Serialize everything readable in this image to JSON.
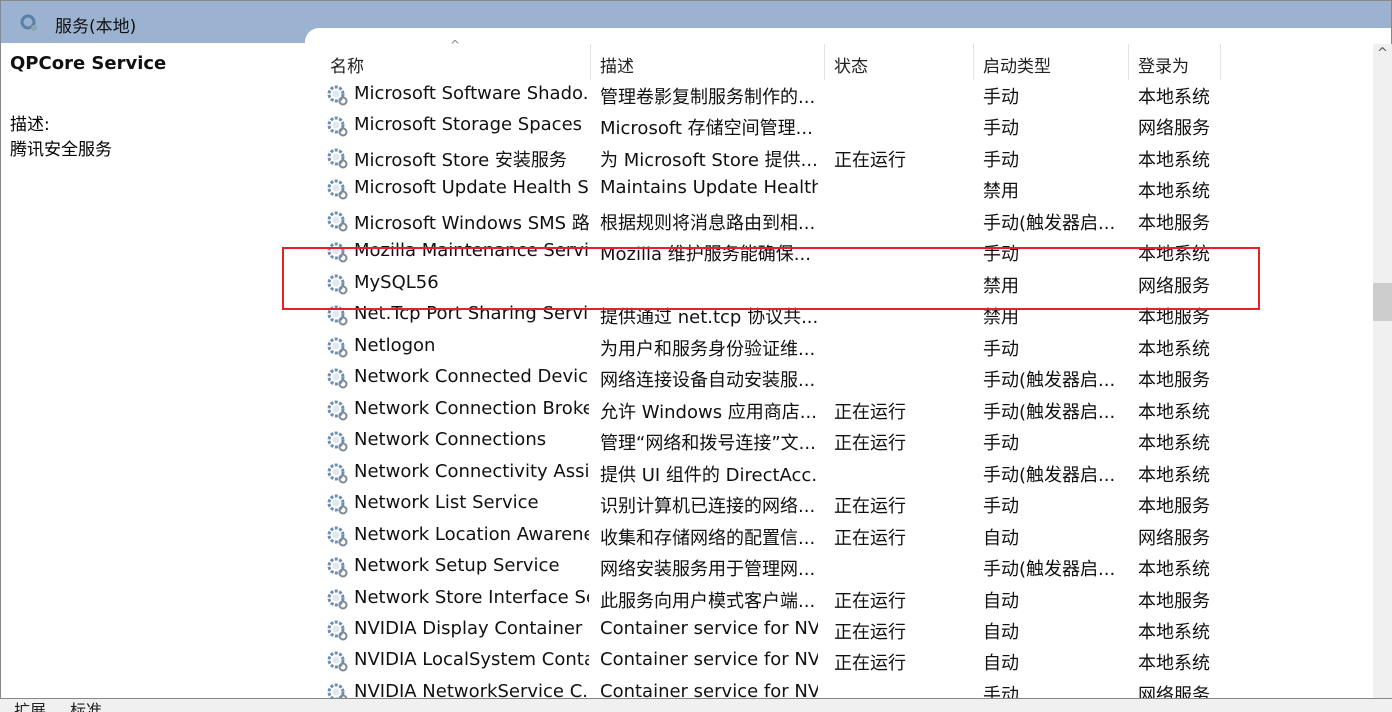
{
  "window": {
    "title": "服务(本地)",
    "icon": "services-gear-icon"
  },
  "details": {
    "service_name": "QPCore Service",
    "description_label": "描述:",
    "description": "腾讯安全服务"
  },
  "columns": [
    "名称",
    "描述",
    "状态",
    "启动类型",
    "登录为"
  ],
  "sort": {
    "column": "名称",
    "direction": "ascending"
  },
  "rows": [
    [
      "Microsoft Software Shado...",
      "管理卷影复制服务制作的...",
      "",
      "手动",
      "本地系统"
    ],
    [
      "Microsoft Storage Spaces S...",
      "Microsoft 存储空间管理...",
      "",
      "手动",
      "网络服务"
    ],
    [
      "Microsoft Store 安装服务",
      "为 Microsoft Store 提供...",
      "正在运行",
      "手动",
      "本地系统"
    ],
    [
      "Microsoft Update Health S...",
      "Maintains Update Health",
      "",
      "禁用",
      "本地系统"
    ],
    [
      "Microsoft Windows SMS 路...",
      "根据规则将消息路由到相...",
      "",
      "手动(触发器启...",
      "本地服务"
    ],
    [
      "Mozilla Maintenance Service",
      "Mozilla 维护服务能确保...",
      "",
      "手动",
      "本地系统"
    ],
    [
      "MySQL56",
      "",
      "",
      "禁用",
      "网络服务"
    ],
    [
      "Net.Tcp Port Sharing Service",
      "提供通过 net.tcp 协议共...",
      "",
      "禁用",
      "本地服务"
    ],
    [
      "Netlogon",
      "为用户和服务身份验证维...",
      "",
      "手动",
      "本地系统"
    ],
    [
      "Network Connected Devic...",
      "网络连接设备自动安装服...",
      "",
      "手动(触发器启...",
      "本地服务"
    ],
    [
      "Network Connection Broker",
      "允许 Windows 应用商店...",
      "正在运行",
      "手动(触发器启...",
      "本地系统"
    ],
    [
      "Network Connections",
      "管理“网络和拨号连接”文...",
      "正在运行",
      "手动",
      "本地系统"
    ],
    [
      "Network Connectivity Assis...",
      "提供 UI 组件的 DirectAcc...",
      "",
      "手动(触发器启...",
      "本地系统"
    ],
    [
      "Network List Service",
      "识别计算机已连接的网络...",
      "正在运行",
      "手动",
      "本地服务"
    ],
    [
      "Network Location Awarene...",
      "收集和存储网络的配置信...",
      "正在运行",
      "自动",
      "网络服务"
    ],
    [
      "Network Setup Service",
      "网络安装服务用于管理网...",
      "",
      "手动(触发器启...",
      "本地系统"
    ],
    [
      "Network Store Interface Se...",
      "此服务向用户模式客户端...",
      "正在运行",
      "自动",
      "本地服务"
    ],
    [
      "NVIDIA Display Container LS",
      "Container service for NV...",
      "正在运行",
      "自动",
      "本地系统"
    ],
    [
      "NVIDIA LocalSystem Conta...",
      "Container service for NV...",
      "正在运行",
      "自动",
      "本地系统"
    ],
    [
      "NVIDIA NetworkService C...",
      "Container service for NV...",
      "",
      "手动",
      "网络服务"
    ]
  ],
  "highlighted_row": "MySQL56",
  "highlight_color": "#e8202a",
  "bottom_tabs": [
    "扩展",
    "标准"
  ]
}
